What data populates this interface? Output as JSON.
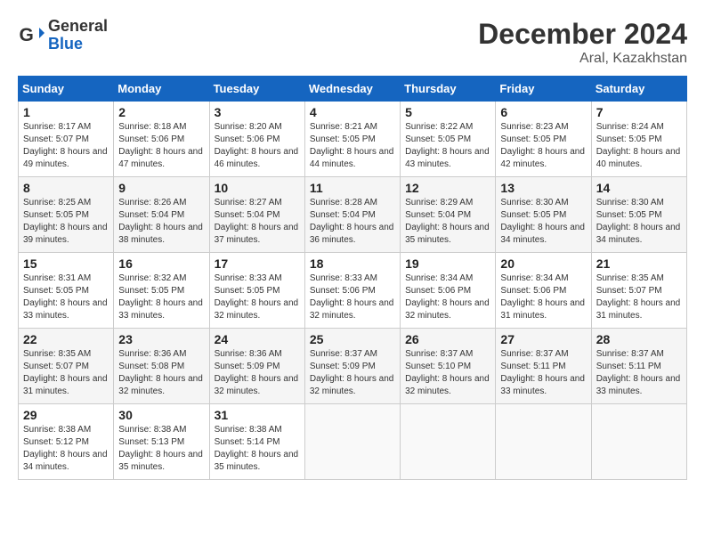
{
  "logo": {
    "general": "General",
    "blue": "Blue"
  },
  "title": {
    "month_year": "December 2024",
    "location": "Aral, Kazakhstan"
  },
  "weekdays": [
    "Sunday",
    "Monday",
    "Tuesday",
    "Wednesday",
    "Thursday",
    "Friday",
    "Saturday"
  ],
  "weeks": [
    [
      {
        "day": "1",
        "sunrise": "8:17 AM",
        "sunset": "5:07 PM",
        "daylight": "8 hours and 49 minutes."
      },
      {
        "day": "2",
        "sunrise": "8:18 AM",
        "sunset": "5:06 PM",
        "daylight": "8 hours and 47 minutes."
      },
      {
        "day": "3",
        "sunrise": "8:20 AM",
        "sunset": "5:06 PM",
        "daylight": "8 hours and 46 minutes."
      },
      {
        "day": "4",
        "sunrise": "8:21 AM",
        "sunset": "5:05 PM",
        "daylight": "8 hours and 44 minutes."
      },
      {
        "day": "5",
        "sunrise": "8:22 AM",
        "sunset": "5:05 PM",
        "daylight": "8 hours and 43 minutes."
      },
      {
        "day": "6",
        "sunrise": "8:23 AM",
        "sunset": "5:05 PM",
        "daylight": "8 hours and 42 minutes."
      },
      {
        "day": "7",
        "sunrise": "8:24 AM",
        "sunset": "5:05 PM",
        "daylight": "8 hours and 40 minutes."
      }
    ],
    [
      {
        "day": "8",
        "sunrise": "8:25 AM",
        "sunset": "5:05 PM",
        "daylight": "8 hours and 39 minutes."
      },
      {
        "day": "9",
        "sunrise": "8:26 AM",
        "sunset": "5:04 PM",
        "daylight": "8 hours and 38 minutes."
      },
      {
        "day": "10",
        "sunrise": "8:27 AM",
        "sunset": "5:04 PM",
        "daylight": "8 hours and 37 minutes."
      },
      {
        "day": "11",
        "sunrise": "8:28 AM",
        "sunset": "5:04 PM",
        "daylight": "8 hours and 36 minutes."
      },
      {
        "day": "12",
        "sunrise": "8:29 AM",
        "sunset": "5:04 PM",
        "daylight": "8 hours and 35 minutes."
      },
      {
        "day": "13",
        "sunrise": "8:30 AM",
        "sunset": "5:05 PM",
        "daylight": "8 hours and 34 minutes."
      },
      {
        "day": "14",
        "sunrise": "8:30 AM",
        "sunset": "5:05 PM",
        "daylight": "8 hours and 34 minutes."
      }
    ],
    [
      {
        "day": "15",
        "sunrise": "8:31 AM",
        "sunset": "5:05 PM",
        "daylight": "8 hours and 33 minutes."
      },
      {
        "day": "16",
        "sunrise": "8:32 AM",
        "sunset": "5:05 PM",
        "daylight": "8 hours and 33 minutes."
      },
      {
        "day": "17",
        "sunrise": "8:33 AM",
        "sunset": "5:05 PM",
        "daylight": "8 hours and 32 minutes."
      },
      {
        "day": "18",
        "sunrise": "8:33 AM",
        "sunset": "5:06 PM",
        "daylight": "8 hours and 32 minutes."
      },
      {
        "day": "19",
        "sunrise": "8:34 AM",
        "sunset": "5:06 PM",
        "daylight": "8 hours and 32 minutes."
      },
      {
        "day": "20",
        "sunrise": "8:34 AM",
        "sunset": "5:06 PM",
        "daylight": "8 hours and 31 minutes."
      },
      {
        "day": "21",
        "sunrise": "8:35 AM",
        "sunset": "5:07 PM",
        "daylight": "8 hours and 31 minutes."
      }
    ],
    [
      {
        "day": "22",
        "sunrise": "8:35 AM",
        "sunset": "5:07 PM",
        "daylight": "8 hours and 31 minutes."
      },
      {
        "day": "23",
        "sunrise": "8:36 AM",
        "sunset": "5:08 PM",
        "daylight": "8 hours and 32 minutes."
      },
      {
        "day": "24",
        "sunrise": "8:36 AM",
        "sunset": "5:09 PM",
        "daylight": "8 hours and 32 minutes."
      },
      {
        "day": "25",
        "sunrise": "8:37 AM",
        "sunset": "5:09 PM",
        "daylight": "8 hours and 32 minutes."
      },
      {
        "day": "26",
        "sunrise": "8:37 AM",
        "sunset": "5:10 PM",
        "daylight": "8 hours and 32 minutes."
      },
      {
        "day": "27",
        "sunrise": "8:37 AM",
        "sunset": "5:11 PM",
        "daylight": "8 hours and 33 minutes."
      },
      {
        "day": "28",
        "sunrise": "8:37 AM",
        "sunset": "5:11 PM",
        "daylight": "8 hours and 33 minutes."
      }
    ],
    [
      {
        "day": "29",
        "sunrise": "8:38 AM",
        "sunset": "5:12 PM",
        "daylight": "8 hours and 34 minutes."
      },
      {
        "day": "30",
        "sunrise": "8:38 AM",
        "sunset": "5:13 PM",
        "daylight": "8 hours and 35 minutes."
      },
      {
        "day": "31",
        "sunrise": "8:38 AM",
        "sunset": "5:14 PM",
        "daylight": "8 hours and 35 minutes."
      },
      null,
      null,
      null,
      null
    ]
  ]
}
